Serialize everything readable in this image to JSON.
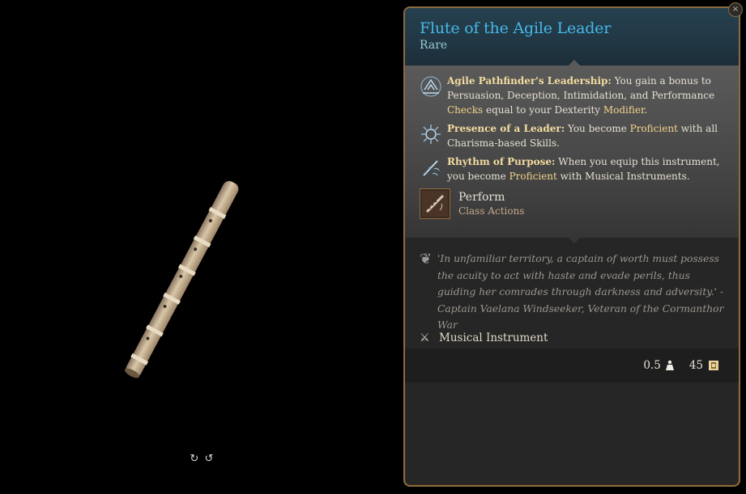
{
  "viewer": {
    "object_name": "flute",
    "rotate_left_icon": "rotate-left-icon",
    "rotate_right_icon": "rotate-right-icon"
  },
  "tooltip": {
    "title": "Flute of the Agile Leader",
    "rarity": "Rare",
    "properties": [
      {
        "icon": "agile-leadership-icon",
        "name": "Agile Pathfinder's Leadership:",
        "text_parts": [
          " You gain a bonus to Persuasion, Deception, Intimidation, and Performance ",
          "Checks",
          " equal to your Dexterity ",
          "Modifier",
          "."
        ]
      },
      {
        "icon": "presence-leader-icon",
        "name": "Presence of a Leader:",
        "text_parts": [
          " You become ",
          "Proficient",
          " with all Charisma-based Skills."
        ]
      },
      {
        "icon": "rhythm-purpose-icon",
        "name": "Rhythm of Purpose:",
        "text_parts": [
          " When you equip this instrument, you become ",
          "Proficient",
          " with Musical Instruments."
        ]
      }
    ],
    "action": {
      "icon": "perform-icon",
      "title": "Perform",
      "subtitle": "Class Actions"
    },
    "lore": "'In unfamiliar territory, a captain of worth must possess the acuity to act with haste and evade perils, thus guiding her comrades through darkness and adversity.' - Captain Vaelana Windseeker, Veteran of the Cormanthor War",
    "item_type": "Musical Instrument",
    "weight": "0.5",
    "value": "45",
    "close_label": "×"
  },
  "colors": {
    "title": "#46b8e6",
    "keyword": "#f3d48a",
    "border": "#8b6b43"
  }
}
